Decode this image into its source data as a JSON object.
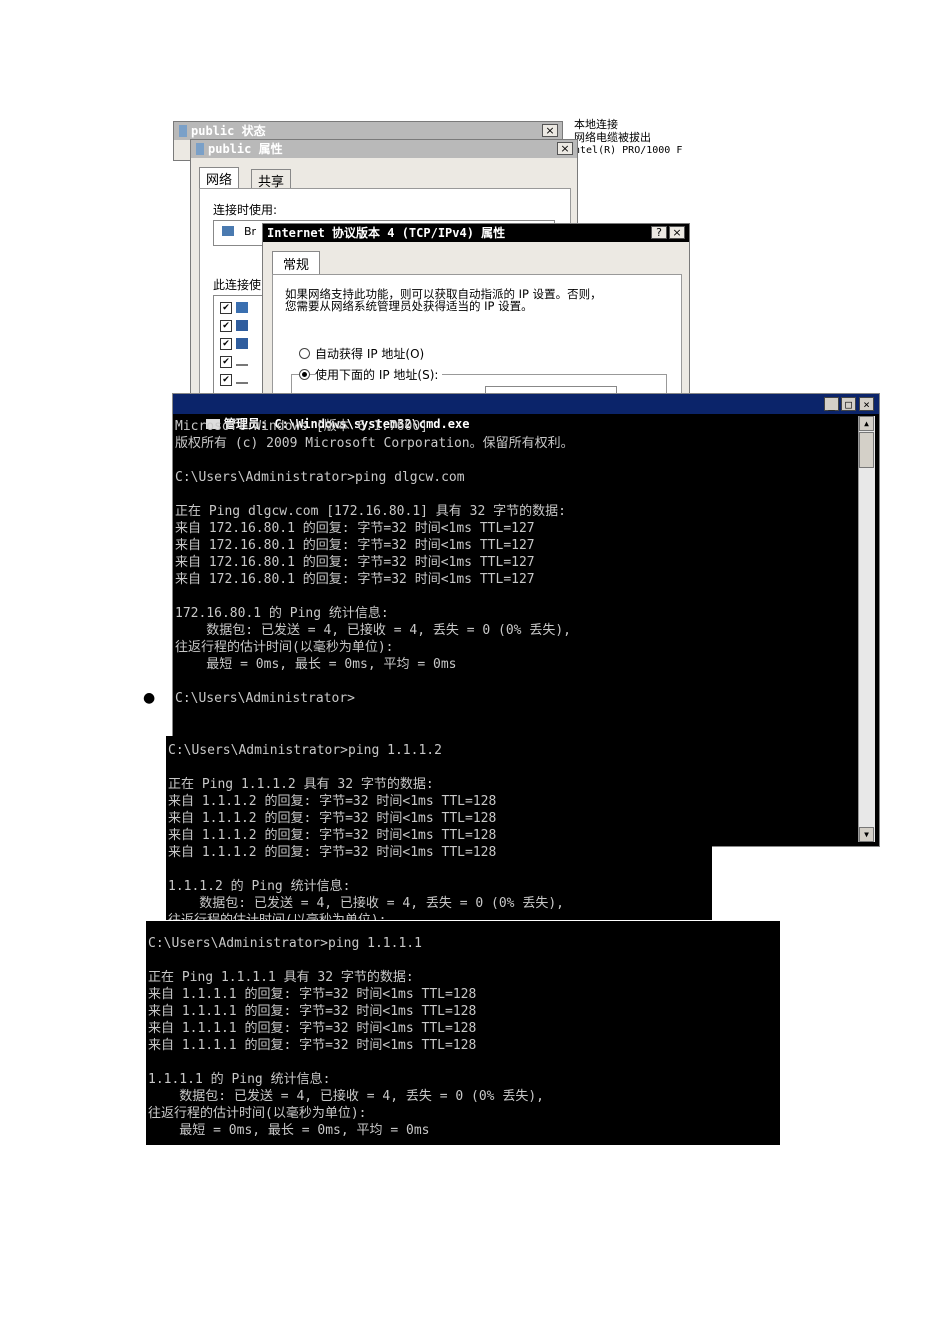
{
  "side_info": {
    "line1": "本地连接",
    "line2": "网络电缆被拔出",
    "line3": "ntel(R) PRO/1000 F"
  },
  "status_window": {
    "title": "public 状态",
    "close": "×"
  },
  "props_window": {
    "title": "public 属性",
    "close": "×",
    "tabs": [
      "网络",
      "共享"
    ],
    "connect_using_label": "连接时使用:",
    "adapter_text": "Br",
    "items_label": "此连接使"
  },
  "ipv4_window": {
    "title": "Internet 协议版本 4 (TCP/IPv4) 属性",
    "help": "?",
    "close": "×",
    "tab": "常规",
    "desc_line1": "如果网络支持此功能，则可以获取自动指派的 IP 设置。否则，",
    "desc_line2": "您需要从网络系统管理员处获得适当的 IP 设置。",
    "radio_auto": "自动获得 IP 地址(O)",
    "radio_manual": "使用下面的 IP 地址(S):"
  },
  "cmd_window": {
    "title": "管理员: C:\\Windows\\system32\\cmd.exe",
    "min": "_",
    "max": "□",
    "close": "×",
    "lines": [
      "Microsoft Windows [版本 6.1.7600]",
      "版权所有 (c) 2009 Microsoft Corporation。保留所有权利。",
      "",
      "C:\\Users\\Administrator>ping dlgcw.com",
      "",
      "正在 Ping dlgcw.com [172.16.80.1] 具有 32 字节的数据:",
      "来自 172.16.80.1 的回复: 字节=32 时间<1ms TTL=127",
      "来自 172.16.80.1 的回复: 字节=32 时间<1ms TTL=127",
      "来自 172.16.80.1 的回复: 字节=32 时间<1ms TTL=127",
      "来自 172.16.80.1 的回复: 字节=32 时间<1ms TTL=127",
      "",
      "172.16.80.1 的 Ping 统计信息:",
      "    数据包: 已发送 = 4, 已接收 = 4, 丢失 = 0 (0% 丢失),",
      "往返行程的估计时间(以毫秒为单位):",
      "    最短 = 0ms, 最长 = 0ms, 平均 = 0ms",
      "",
      "C:\\Users\\Administrator>"
    ]
  },
  "bullet": "●",
  "console2": {
    "lines": [
      "C:\\Users\\Administrator>ping 1.1.1.2",
      "",
      "正在 Ping 1.1.1.2 具有 32 字节的数据:",
      "来自 1.1.1.2 的回复: 字节=32 时间<1ms TTL=128",
      "来自 1.1.1.2 的回复: 字节=32 时间<1ms TTL=128",
      "来自 1.1.1.2 的回复: 字节=32 时间<1ms TTL=128",
      "来自 1.1.1.2 的回复: 字节=32 时间<1ms TTL=128",
      "",
      "1.1.1.2 的 Ping 统计信息:",
      "    数据包: 已发送 = 4, 已接收 = 4, 丢失 = 0 (0% 丢失),",
      "往返行程的估计时间(以毫秒为单位):"
    ]
  },
  "console3": {
    "lines": [
      "C:\\Users\\Administrator>ping 1.1.1.1",
      "",
      "正在 Ping 1.1.1.1 具有 32 字节的数据:",
      "来自 1.1.1.1 的回复: 字节=32 时间<1ms TTL=128",
      "来自 1.1.1.1 的回复: 字节=32 时间<1ms TTL=128",
      "来自 1.1.1.1 的回复: 字节=32 时间<1ms TTL=128",
      "来自 1.1.1.1 的回复: 字节=32 时间<1ms TTL=128",
      "",
      "1.1.1.1 的 Ping 统计信息:",
      "    数据包: 已发送 = 4, 已接收 = 4, 丢失 = 0 (0% 丢失),",
      "往返行程的估计时间(以毫秒为单位):",
      "    最短 = 0ms, 最长 = 0ms, 平均 = 0ms"
    ]
  }
}
